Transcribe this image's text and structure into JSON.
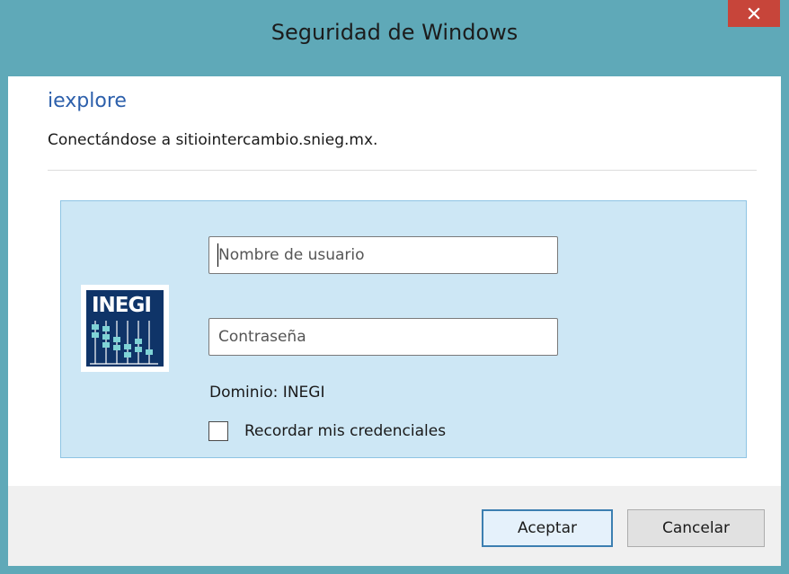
{
  "dialog": {
    "title": "Seguridad de Windows",
    "app_name": "iexplore",
    "connecting_text": "Conectándose a sitiointercambio.snieg.mx."
  },
  "logo": {
    "text": "INEGI",
    "icon": "inegi-logo"
  },
  "form": {
    "username_placeholder": "Nombre de usuario",
    "username_value": "",
    "password_placeholder": "Contraseña",
    "password_value": "",
    "domain_text": "Dominio: INEGI",
    "remember_label": "Recordar mis credenciales",
    "remember_checked": false
  },
  "buttons": {
    "ok_label": "Aceptar",
    "cancel_label": "Cancelar"
  },
  "icons": {
    "close": "close-icon"
  },
  "colors": {
    "window_frame": "#5fa9b8",
    "close_button": "#c7453a",
    "app_name": "#2c5fab",
    "credential_panel": "#cde7f5",
    "logo_background": "#0f3468"
  }
}
